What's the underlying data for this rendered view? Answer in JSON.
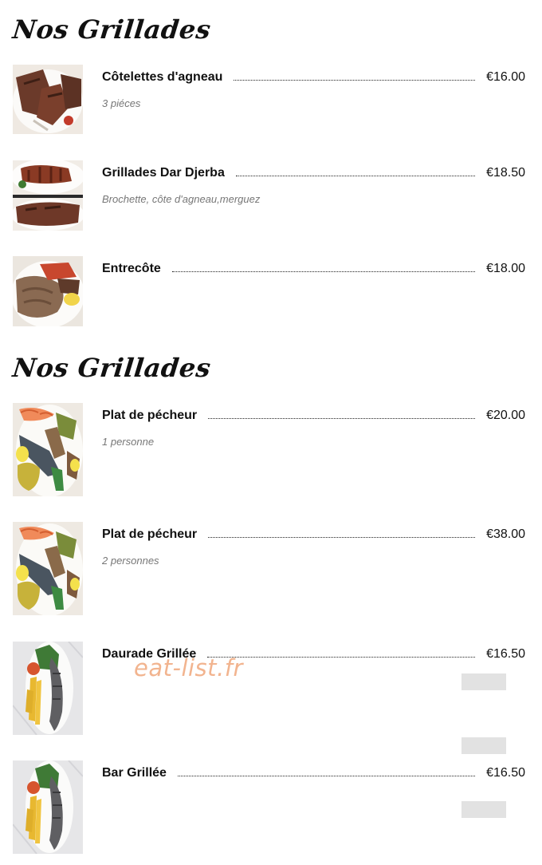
{
  "sections": [
    {
      "title": "Nos Grillades",
      "items": [
        {
          "name": "Côtelettes d'agneau",
          "price": "€16.00",
          "description": "3 piéces",
          "image": "lamb-chops-photo"
        },
        {
          "name": "Grillades Dar Djerba",
          "price": "€18.50",
          "description": "Brochette, côte d'agneau,merguez",
          "image": "mixed-grill-photo"
        },
        {
          "name": "Entrecôte",
          "price": "€18.00",
          "description": "",
          "image": "entrecote-photo"
        }
      ]
    },
    {
      "title": "Nos Grillades",
      "items": [
        {
          "name": "Plat de pécheur",
          "price": "€20.00",
          "description": "1 personne",
          "image": "seafood-platter-photo"
        },
        {
          "name": "Plat de pécheur",
          "price": "€38.00",
          "description": "2 personnes",
          "image": "seafood-platter-photo"
        },
        {
          "name": "Daurade Grillée",
          "price": "€16.50",
          "description": "",
          "image": "grilled-fish-photo"
        },
        {
          "name": "Bar Grillée",
          "price": "€16.50",
          "description": "",
          "image": "grilled-fish-photo"
        }
      ]
    }
  ],
  "watermark": "eat-list.fr"
}
